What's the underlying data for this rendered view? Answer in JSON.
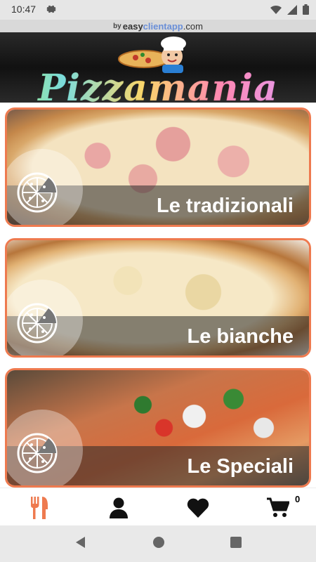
{
  "status": {
    "time": "10:47",
    "gear_icon": "gear-icon",
    "wifi_icon": "wifi-icon",
    "signal_icon": "signal-icon",
    "battery_icon": "battery-icon"
  },
  "brand": {
    "by": "by",
    "easy": "easy",
    "client": "clientapp",
    "com": ".com"
  },
  "header": {
    "logo_text": "Pizzamania"
  },
  "categories": [
    {
      "label": "Le tradizionali",
      "icon": "pizza-icon"
    },
    {
      "label": "Le bianche",
      "icon": "pizza-icon"
    },
    {
      "label": "Le Speciali",
      "icon": "pizza-icon"
    }
  ],
  "bottom_nav": {
    "menu_icon": "fork-knife-icon",
    "user_icon": "user-icon",
    "fav_icon": "heart-icon",
    "cart_icon": "cart-icon",
    "cart_count": "0",
    "active_color": "#ee7a4f"
  },
  "colors": {
    "accent": "#ee7a4f",
    "header_bg": "#1a1a1a"
  }
}
